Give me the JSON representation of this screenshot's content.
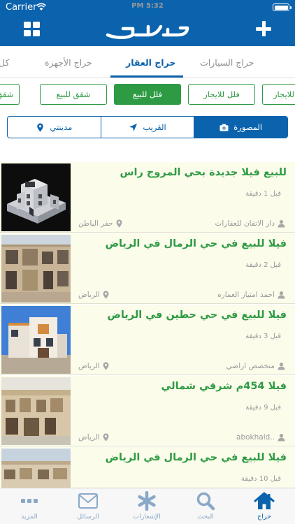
{
  "status_bar": {
    "carrier": "Carrier",
    "time": "5:32 PM"
  },
  "header": {
    "brand": "حراج",
    "brand_icon": "haraj-logo",
    "menu_icon": "grid-icon",
    "add_icon": "plus-icon"
  },
  "categories": [
    {
      "label": "كل",
      "active": false
    },
    {
      "label": "حراج الأجهزة",
      "active": false
    },
    {
      "label": "حراج العقار",
      "active": true
    },
    {
      "label": "حراج السيارات",
      "active": false
    }
  ],
  "subcategories": [
    {
      "label": "شقق",
      "active": false
    },
    {
      "label": "شقق للبيع",
      "active": false
    },
    {
      "label": "فلل للبيع",
      "active": true
    },
    {
      "label": "فلل للايجار",
      "active": false
    },
    {
      "label": "للايجار",
      "active": false
    }
  ],
  "filters": [
    {
      "label": "مدينتي",
      "icon": "location-pin-icon",
      "active": false
    },
    {
      "label": "القريب",
      "icon": "navigation-arrow-icon",
      "active": false
    },
    {
      "label": "المصورة",
      "icon": "camera-icon",
      "active": true
    }
  ],
  "listings": [
    {
      "title": "للبيع فيلا جديدة بحي المروج راس",
      "time": "قبل 1 دقيقة",
      "user": "دار الاتقان للعقارات",
      "city": "حفر الباطن"
    },
    {
      "title": "فيلا للبيع في حي الرمال في الرياض",
      "time": "قبل 2 دقيقة",
      "user": "احمد امتياز العماره",
      "city": "الرياض"
    },
    {
      "title": "فيلا للبيع في حي حطين في الرياض",
      "time": "قبل 3 دقيقة",
      "user": "متخصص اراضي",
      "city": "الرياض"
    },
    {
      "title": "فيلا 454م شرقي شمالي",
      "time": "قبل 9 دقيقة",
      "user": "..abokhald",
      "city": "الرياض"
    },
    {
      "title": "فيلا للبيع في حي الرمال في الرياض",
      "time": "قبل 10 دقيقة",
      "user": "",
      "city": ""
    }
  ],
  "tabbar": [
    {
      "label": "المزيد",
      "icon": "more-dots-icon",
      "active": false
    },
    {
      "label": "الرسائل",
      "icon": "envelope-icon",
      "active": false
    },
    {
      "label": "الإشعارات",
      "icon": "asterisk-icon",
      "active": false
    },
    {
      "label": "البحث",
      "icon": "search-icon",
      "active": false
    },
    {
      "label": "حراج",
      "icon": "home-icon",
      "active": true
    }
  ],
  "colors": {
    "primary": "#0b63ad",
    "green": "#2e9b44",
    "listing_bg": "#fcfceb",
    "muted": "#9a9a9a",
    "tab_inactive": "#8aa9c8"
  }
}
